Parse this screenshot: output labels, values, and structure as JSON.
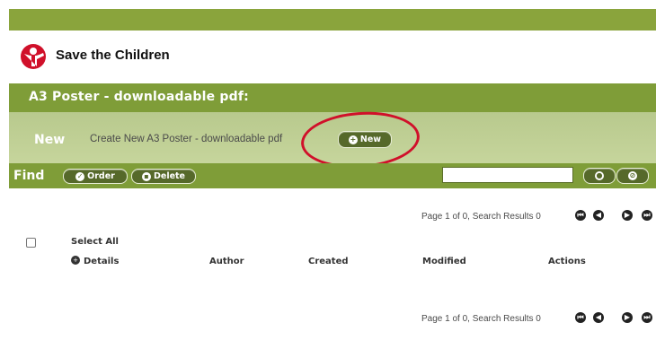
{
  "brand": {
    "name": "Save the Children",
    "color": "#d0102a"
  },
  "page": {
    "title": "A3 Poster - downloadable pdf:"
  },
  "new_section": {
    "label": "New",
    "description": "Create New A3 Poster - downloadable pdf",
    "button_label": "New"
  },
  "find_section": {
    "label": "Find",
    "order_label": "Order",
    "delete_label": "Delete",
    "search_value": ""
  },
  "pagination": {
    "text": "Page 1 of 0, Search Results 0"
  },
  "table": {
    "select_all": "Select All",
    "columns": [
      "Details",
      "Author",
      "Created",
      "Modified",
      "Actions"
    ]
  },
  "colors": {
    "header_green": "#7f9d38",
    "light_green": "#c6d59c",
    "button_green": "#56692a"
  },
  "icons": [
    "first-page-icon",
    "prev-page-icon",
    "next-page-icon",
    "last-page-icon",
    "search-icon",
    "clear-icon",
    "plus-icon",
    "trash-icon",
    "order-icon"
  ]
}
